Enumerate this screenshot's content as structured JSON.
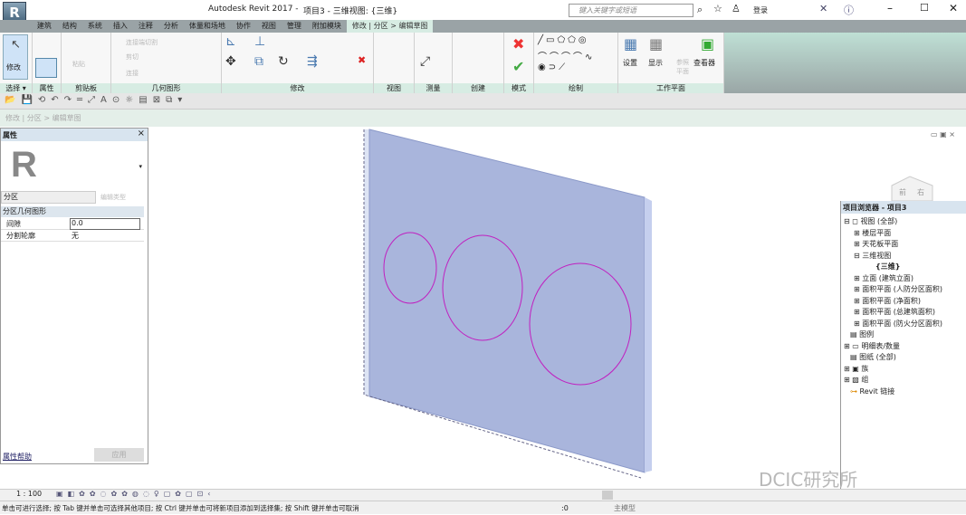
{
  "title": {
    "app": "Autodesk Revit 2017 -",
    "doc": "项目3 - 三维视图: {三维}",
    "search_placeholder": "键入关键字或短语",
    "login": "登录",
    "app_button": "R"
  },
  "tabs": [
    "建筑",
    "结构",
    "系统",
    "插入",
    "注释",
    "分析",
    "体量和场地",
    "协作",
    "视图",
    "管理",
    "附加模块",
    "修改 | 分区 > 编辑草图"
  ],
  "ribbon": {
    "modify": "修改",
    "paste": "粘贴",
    "join_cut": "连接端切割",
    "cut": "剪切",
    "join": "连接",
    "panels": [
      "选择 ▾",
      "属性",
      "剪贴板",
      "几何图形",
      "修改",
      "视图",
      "测量",
      "创建",
      "模式",
      "绘制",
      "工作平面"
    ],
    "wp_set": "设置",
    "wp_show": "显示",
    "wp_ref": "参照平面",
    "wp_viewer": "查看器"
  },
  "optbar": "修改 | 分区 > 编辑草图",
  "properties": {
    "title": "属性",
    "type": "分区",
    "edit_type": "编辑类型",
    "group": "分区几何图形",
    "rows": [
      {
        "k": "间隙",
        "v": "0.0"
      },
      {
        "k": "分割轮廓",
        "v": "无"
      }
    ],
    "help": "属性帮助",
    "apply": "应用"
  },
  "browser": {
    "title": "项目浏览器 - 项目3",
    "items": [
      "视图 (全部)",
      "楼层平面",
      "天花板平面",
      "三维视图",
      "{三维}",
      "立面 (建筑立面)",
      "面积平面 (人防分区面积)",
      "面积平面 (净面积)",
      "面积平面 (总建筑面积)",
      "面积平面 (防火分区面积)",
      "图例",
      "明细表/数量",
      "图纸 (全部)",
      "族",
      "组",
      "Revit 链接"
    ]
  },
  "viewcube": {
    "left": "前",
    "right": "右"
  },
  "viewbar": {
    "scale": "1 : 100"
  },
  "status": {
    "text": "单击可进行选择; 按 Tab 键并单击可选择其他项目; 按 Ctrl 键并单击可将新项目添加到选择集; 按 Shift 键并单击可取消",
    "count": ":0",
    "model": "主模型"
  },
  "watermark": "DCIC研究所",
  "colors": {
    "wall": "#a9b5dc",
    "sketch": "#c020c0",
    "accent": "#d7ece3"
  }
}
